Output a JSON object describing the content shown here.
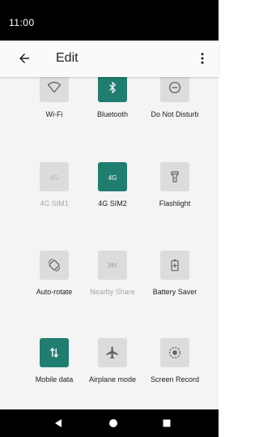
{
  "status_bar": {
    "time": "11:00"
  },
  "toolbar": {
    "title": "Edit",
    "back_icon": "arrow-back-icon",
    "overflow_icon": "more-vert-icon"
  },
  "tiles": [
    {
      "label": "Wi-Fi",
      "icon": "wifi-icon",
      "active": false,
      "dimmed": false
    },
    {
      "label": "Bluetooth",
      "icon": "bluetooth-icon",
      "active": true,
      "dimmed": false
    },
    {
      "label": "Do Not Disturb",
      "icon": "do-not-disturb-icon",
      "active": false,
      "dimmed": false
    },
    {
      "label": "4G SIM1",
      "icon": "signal-4g-icon",
      "icon_text": "4G",
      "active": false,
      "dimmed": true
    },
    {
      "label": "4G SIM2",
      "icon": "signal-4g-icon",
      "icon_text": "4G",
      "active": true,
      "dimmed": false
    },
    {
      "label": "Flashlight",
      "icon": "flashlight-icon",
      "active": false,
      "dimmed": false
    },
    {
      "label": "Auto-rotate",
      "icon": "auto-rotate-icon",
      "active": false,
      "dimmed": false
    },
    {
      "label": "Nearby Share",
      "icon": "nearby-share-icon",
      "active": false,
      "dimmed": true
    },
    {
      "label": "Battery Saver",
      "icon": "battery-saver-icon",
      "active": false,
      "dimmed": false
    },
    {
      "label": "Mobile data",
      "icon": "mobile-data-icon",
      "active": true,
      "dimmed": false
    },
    {
      "label": "Airplane mode",
      "icon": "airplane-icon",
      "active": false,
      "dimmed": false
    },
    {
      "label": "Screen Record",
      "icon": "screen-record-icon",
      "active": false,
      "dimmed": false
    }
  ],
  "nav_bar": {
    "back_icon": "nav-back-icon",
    "home_icon": "nav-home-icon",
    "recents_icon": "nav-recents-icon"
  },
  "colors": {
    "accent": "#1f7e6f",
    "tile_inactive": "#dcdcdc",
    "icon_inactive": "#5f6368",
    "icon_dimmed": "#b4b4b4"
  }
}
